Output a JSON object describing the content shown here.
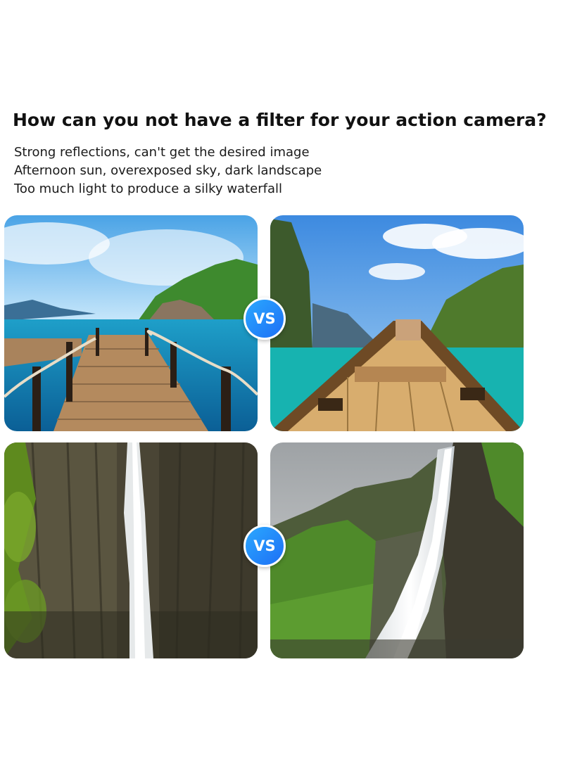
{
  "headline": "How can you not have a filter for your action camera?",
  "points": [
    "Strong reflections, can't get the desired image",
    "Afternoon sun, overexposed sky, dark landscape",
    "Too much light to produce a silky waterfall"
  ],
  "comparisons": [
    {
      "badge": "VS",
      "left_photo": "pier-overexposed-photo",
      "right_photo": "boat-filtered-photo"
    },
    {
      "badge": "VS",
      "left_photo": "waterfall-overexposed-photo",
      "right_photo": "waterfall-silky-photo"
    }
  ],
  "colors": {
    "badge_blue": "#1e6ff5",
    "badge_light": "#2aa8ff",
    "headline": "#111111"
  }
}
